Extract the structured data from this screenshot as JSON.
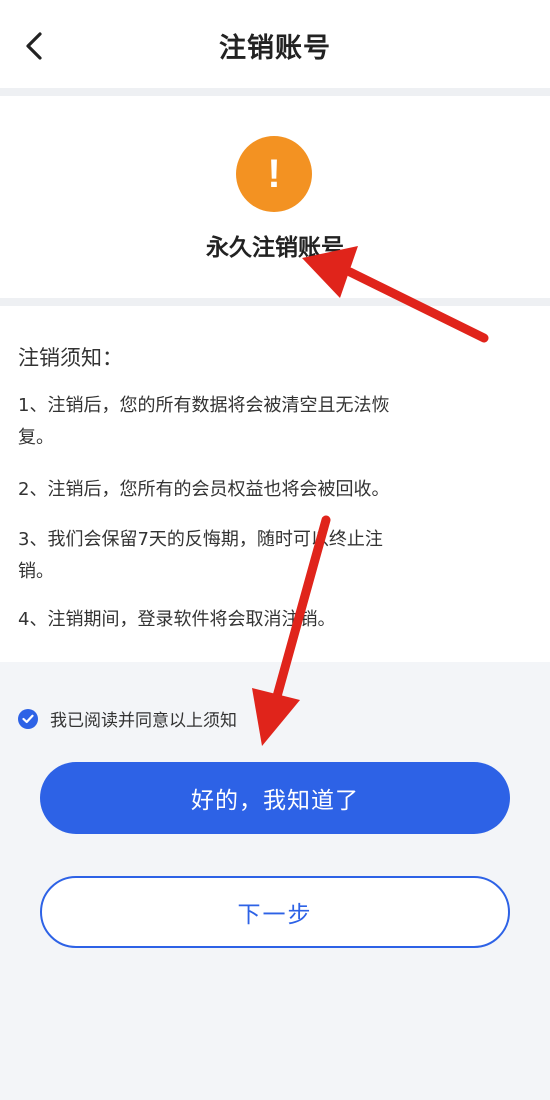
{
  "header": {
    "title": "注销账号",
    "back_icon": "chevron-left-icon"
  },
  "hero": {
    "icon": "exclamation-icon",
    "icon_symbol": "!",
    "icon_color": "#f39222",
    "heading": "永久注销账号"
  },
  "notice": {
    "heading": "注销须知：",
    "items": [
      {
        "line1": "1、注销后，您的所有数据将会被清空且无法恢",
        "line2": "复。"
      },
      {
        "line1": "2、注销后，您所有的会员权益也将会被回收。"
      },
      {
        "line1": "3、我们会保留7天的反悔期，随时可以终止注",
        "line2": "销。"
      },
      {
        "line1": "4、注销期间，登录软件将会取消注销。"
      }
    ]
  },
  "agreement": {
    "checked": true,
    "label": "我已阅读并同意以上须知"
  },
  "buttons": {
    "primary_label": "好的，我知道了",
    "secondary_label": "下一步"
  },
  "colors": {
    "accent": "#2d62e6",
    "warning": "#f39222",
    "annotation_arrow": "#e0241b"
  }
}
